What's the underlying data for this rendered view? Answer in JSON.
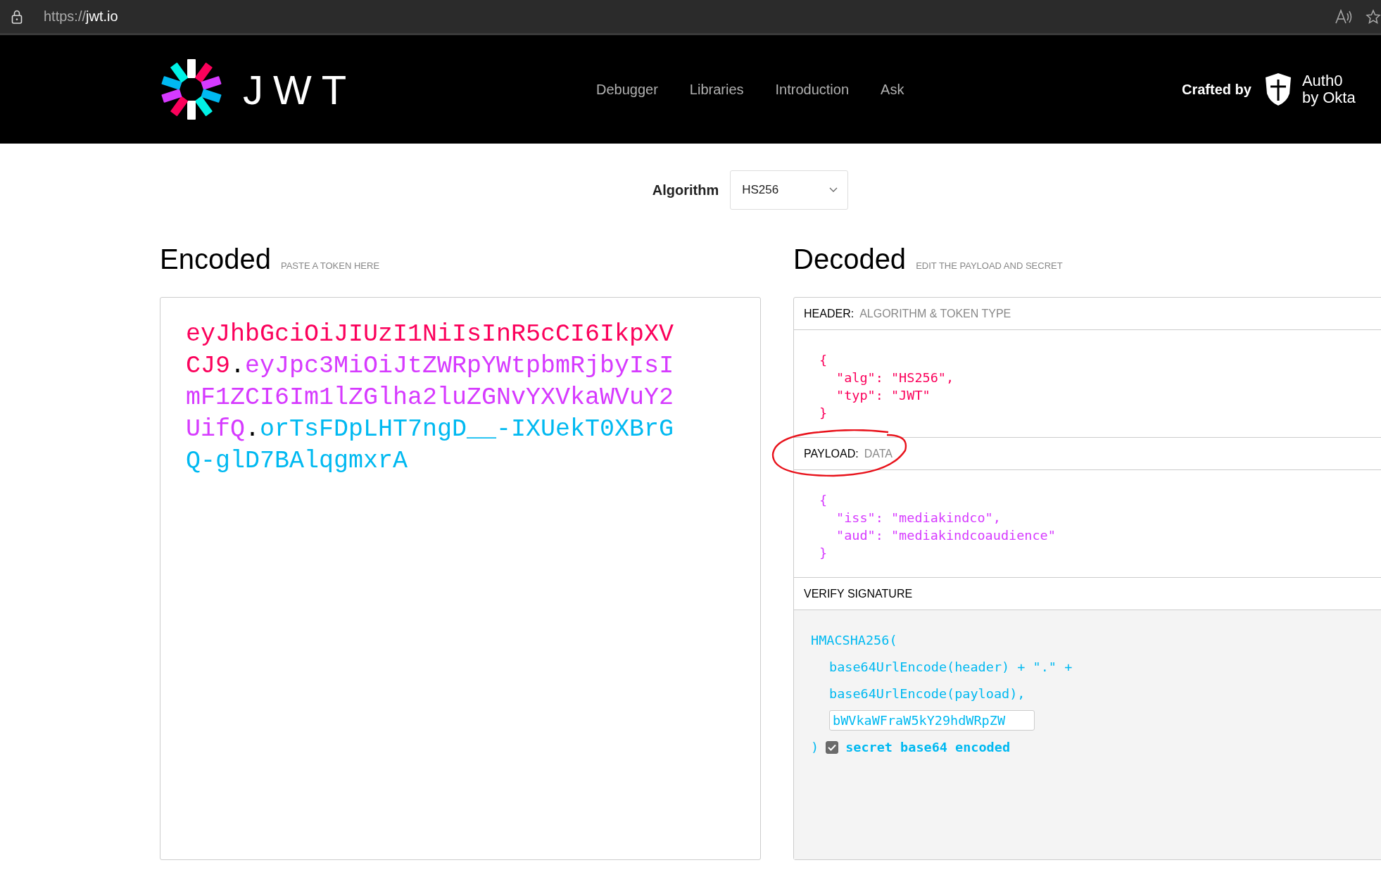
{
  "browser": {
    "url_scheme": "https://",
    "url_host": "jwt.io"
  },
  "header": {
    "logo_text": "JWT",
    "nav": [
      {
        "label": "Debugger",
        "selected": false
      },
      {
        "label": "Libraries",
        "selected": false
      },
      {
        "label": "Introduction",
        "selected": false
      },
      {
        "label": "Ask",
        "selected": false
      }
    ],
    "crafted_by": "Crafted by",
    "brand_line1": "Auth0",
    "brand_line2": "by Okta"
  },
  "algorithm": {
    "label": "Algorithm",
    "value": "HS256"
  },
  "encoded": {
    "title": "Encoded",
    "hint": "PASTE A TOKEN HERE",
    "token": [
      {
        "kind": "header",
        "text": "eyJhbGciOiJIUzI1NiIsInR5cCI6IkpXVCJ9"
      },
      {
        "kind": "dot",
        "text": "."
      },
      {
        "kind": "payload",
        "text": "eyJpc3MiOiJtZWRpYWtpbmRjbyIsImF1ZCI6Im1lZGlha2luZGNvYXVkaWVuY2UifQ"
      },
      {
        "kind": "dot",
        "text": "."
      },
      {
        "kind": "signature",
        "text": "orTsFDpLHT7ngD__-IXUekT0XBrGQ-glD7BAlqgmxrA"
      }
    ]
  },
  "decoded": {
    "title": "Decoded",
    "hint": "EDIT THE PAYLOAD AND SECRET",
    "sections": [
      {
        "kind": "header",
        "title": "HEADER:",
        "subtitle": "ALGORITHM & TOKEN TYPE",
        "lines": [
          {
            "kind": "brace",
            "text": "{"
          },
          {
            "kind": "entry",
            "text": "\"alg\": \"HS256\","
          },
          {
            "kind": "entry",
            "text": "\"typ\": \"JWT\""
          },
          {
            "kind": "brace",
            "text": "}"
          }
        ]
      },
      {
        "kind": "payload",
        "title": "PAYLOAD:",
        "subtitle": "DATA",
        "lines": [
          {
            "kind": "brace",
            "text": "{"
          },
          {
            "kind": "entry",
            "text": "\"iss\": \"mediakindco\","
          },
          {
            "kind": "entry",
            "text": "\"aud\": \"mediakindcoaudience\""
          },
          {
            "kind": "brace",
            "text": "}"
          }
        ]
      },
      {
        "kind": "verify",
        "title": "VERIFY SIGNATURE",
        "lines": [
          {
            "kind": "fn",
            "text": "HMACSHA256("
          },
          {
            "kind": "arg",
            "text": "base64UrlEncode(header) + \".\" +"
          },
          {
            "kind": "arg",
            "text": "base64UrlEncode(payload),"
          }
        ],
        "secret": "bWVkaWFraW5kY29hdWRpZW",
        "closing": ")",
        "base64": {
          "label": "secret base64 encoded",
          "checked": true
        }
      }
    ]
  }
}
